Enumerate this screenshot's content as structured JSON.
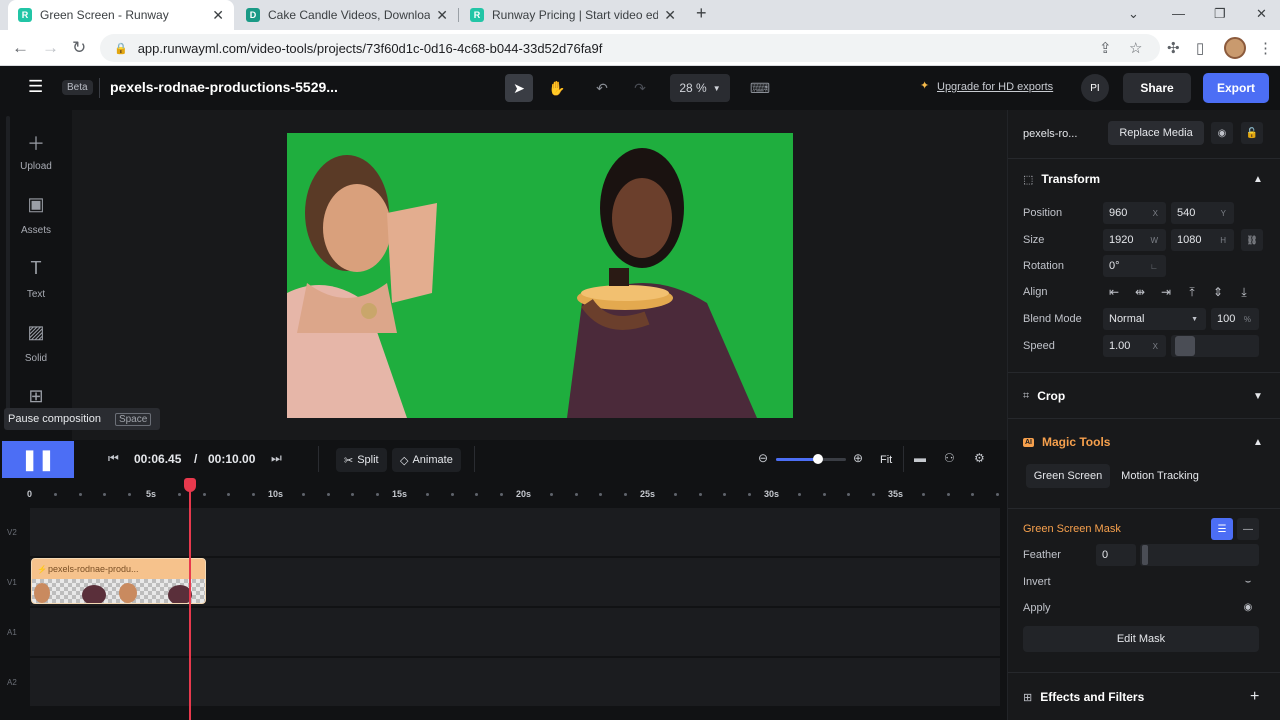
{
  "browser": {
    "tabs": [
      {
        "title": "Green Screen - Runway",
        "favicon": "R",
        "color": "#22c5a6"
      },
      {
        "title": "Cake Candle Videos, Download F",
        "favicon": "D",
        "color": "#1a9a86"
      },
      {
        "title": "Runway Pricing | Start video editi",
        "favicon": "R",
        "color": "#22c5a6"
      }
    ],
    "url": "app.runwayml.com/video-tools/projects/73f60d1c-0d16-4c68-b044-33d52d76fa9f"
  },
  "app": {
    "beta": "Beta",
    "project_name": "pexels-rodnae-productions-5529...",
    "zoom": "28 %",
    "upgrade": "Upgrade for HD exports",
    "user_initials": "PI",
    "share": "Share",
    "export": "Export"
  },
  "sidebar": {
    "items": [
      {
        "label": "Upload"
      },
      {
        "label": "Assets"
      },
      {
        "label": "Text"
      },
      {
        "label": "Solid"
      }
    ]
  },
  "tooltip": {
    "text": "Pause composition",
    "key": "Space"
  },
  "transport": {
    "current": "00:06.45",
    "sep": "/",
    "total": "00:10.00",
    "split": "Split",
    "animate": "Animate",
    "fit": "Fit",
    "zoom_level": 0.6
  },
  "ruler": {
    "labels": [
      "0",
      "5s",
      "10s",
      "15s",
      "20s",
      "25s",
      "30s",
      "35s"
    ]
  },
  "tracks": {
    "labels": [
      "V2",
      "V1",
      "A1",
      "A2"
    ],
    "clip_title": "pexels-rodnae-produ..."
  },
  "panel": {
    "layer_name": "pexels-ro...",
    "replace_media": "Replace Media",
    "transform": "Transform",
    "position_label": "Position",
    "position_x": "960",
    "position_y": "540",
    "size_label": "Size",
    "size_w": "1920",
    "size_h": "1080",
    "rotation_label": "Rotation",
    "rotation": "0°",
    "align_label": "Align",
    "blend_label": "Blend Mode",
    "blend_mode": "Normal",
    "opacity": "100",
    "speed_label": "Speed",
    "speed": "1.00",
    "crop": "Crop",
    "magic_tools": "Magic Tools",
    "ai_badge": "AI",
    "green_screen": "Green Screen",
    "motion_tracking": "Motion Tracking",
    "mask_title": "Green Screen Mask",
    "feather_label": "Feather",
    "feather": "0",
    "invert_label": "Invert",
    "apply_label": "Apply",
    "edit_mask": "Edit Mask",
    "effects": "Effects and Filters",
    "units": {
      "x": "X",
      "y": "Y",
      "w": "W",
      "h": "H",
      "pct": "%"
    }
  }
}
